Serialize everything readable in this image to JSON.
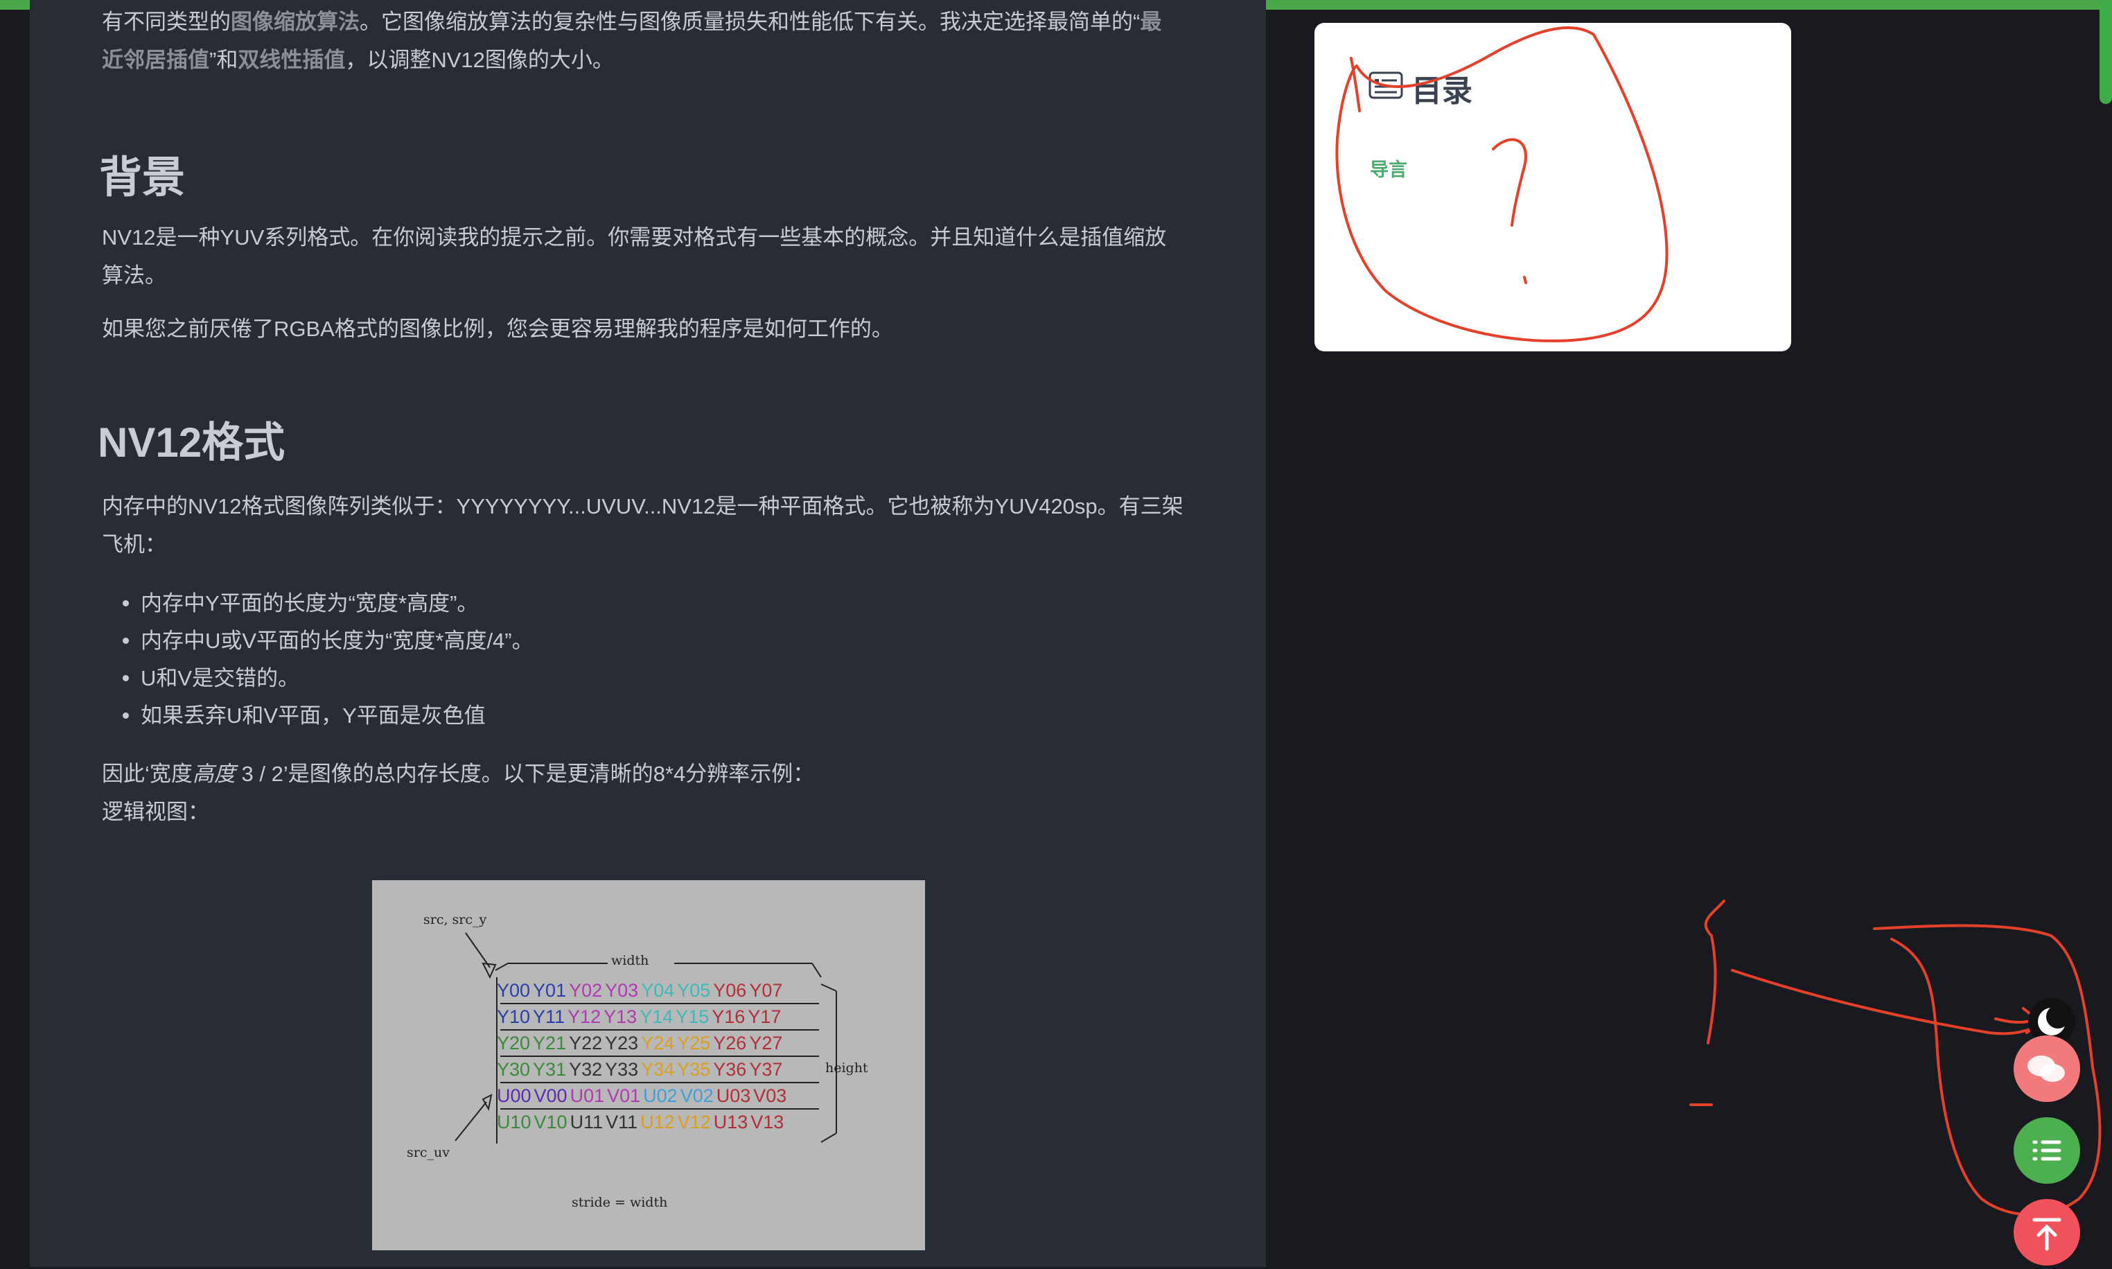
{
  "article": {
    "intro_line1_prefix": "有不同类型的",
    "intro_link1": "图像缩放算法",
    "intro_line1_suffix": "。它图像缩放算法的复杂性与图像质量损失和性能低下有关。我决定选择最简单的“",
    "intro_link2a": "最",
    "intro_link2b": "近邻居插值",
    "intro_line2_mid": "”和",
    "intro_link3": "双线性插值",
    "intro_line2_suffix": "，以调整NV12图像的大小。",
    "h_background": "背景",
    "bg_p1_line1": "NV12是一种YUV系列格式。在你阅读我的提示之前。你需要对格式有一些基本的概念。并且知道什么是插值缩放",
    "bg_p1_line2": "算法。",
    "bg_p2": "如果您之前厌倦了RGBA格式的图像比例，您会更容易理解我的程序是如何工作的。",
    "h_nv12": "NV12格式",
    "nv12_p1_line1": "内存中的NV12格式图像阵列类似于：YYYYYYYY...UVUV...NV12是一种平面格式。它也被称为YUV420sp。有三架",
    "nv12_p1_line2": "飞机：",
    "bullets": [
      "内存中Y平面的长度为“宽度*高度”。",
      "内存中U或V平面的长度为“宽度*高度/4”。",
      "U和V是交错的。",
      "如果丢弃U和V平面，Y平面是灰色值"
    ],
    "total_prefix": "因此‘宽度",
    "total_italic": "高度",
    "total_suffix": " 3 / 2’是图像的总内存长度。以下是更清晰的8*4分辨率示例：",
    "logical_view": "逻辑视图："
  },
  "figure": {
    "src_y_label": "src, src_y",
    "width_label": "width",
    "height_label": "height",
    "src_uv_label": "src_uv",
    "stride_label": "stride = width",
    "rows": [
      [
        "Y00",
        "Y01",
        "Y02",
        "Y03",
        "Y04",
        "Y05",
        "Y06",
        "Y07"
      ],
      [
        "Y10",
        "Y11",
        "Y12",
        "Y13",
        "Y14",
        "Y15",
        "Y16",
        "Y17"
      ],
      [
        "Y20",
        "Y21",
        "Y22",
        "Y23",
        "Y24",
        "Y25",
        "Y26",
        "Y27"
      ],
      [
        "Y30",
        "Y31",
        "Y32",
        "Y33",
        "Y34",
        "Y35",
        "Y36",
        "Y37"
      ],
      [
        "U00",
        "V00",
        "U01",
        "V01",
        "U02",
        "V02",
        "U03",
        "V03"
      ],
      [
        "U10",
        "V10",
        "U11",
        "V11",
        "U12",
        "V12",
        "U13",
        "V13"
      ]
    ],
    "row_colors": [
      [
        "#2c3ea8",
        "#2c3ea8",
        "#b03ab0",
        "#b03ab0",
        "#3fb8b8",
        "#3fb8b8",
        "#b0303a",
        "#b0303a"
      ],
      [
        "#2c3ea8",
        "#2c3ea8",
        "#b03ab0",
        "#b03ab0",
        "#3fb8b8",
        "#3fb8b8",
        "#b0303a",
        "#b0303a"
      ],
      [
        "#3a8a3a",
        "#3a8a3a",
        "#333333",
        "#333333",
        "#d9a020",
        "#d9a020",
        "#b0303a",
        "#b0303a"
      ],
      [
        "#3a8a3a",
        "#3a8a3a",
        "#333333",
        "#333333",
        "#d9a020",
        "#d9a020",
        "#b0303a",
        "#b0303a"
      ],
      [
        "#5a2cb0",
        "#5a2cb0",
        "#b03ab0",
        "#b03ab0",
        "#3fa0d8",
        "#3fa0d8",
        "#b0303a",
        "#b0303a"
      ],
      [
        "#3a8a3a",
        "#3a8a3a",
        "#333333",
        "#333333",
        "#d9a020",
        "#d9a020",
        "#b0303a",
        "#b0303a"
      ]
    ]
  },
  "toc": {
    "title": "目录",
    "items": [
      "导言"
    ]
  },
  "colors": {
    "accent_green": "#4aa84a",
    "annotation_red": "#e5402a",
    "chat_fab": "#f27a7a",
    "list_fab": "#4caf50",
    "top_fab": "#f0515a"
  }
}
